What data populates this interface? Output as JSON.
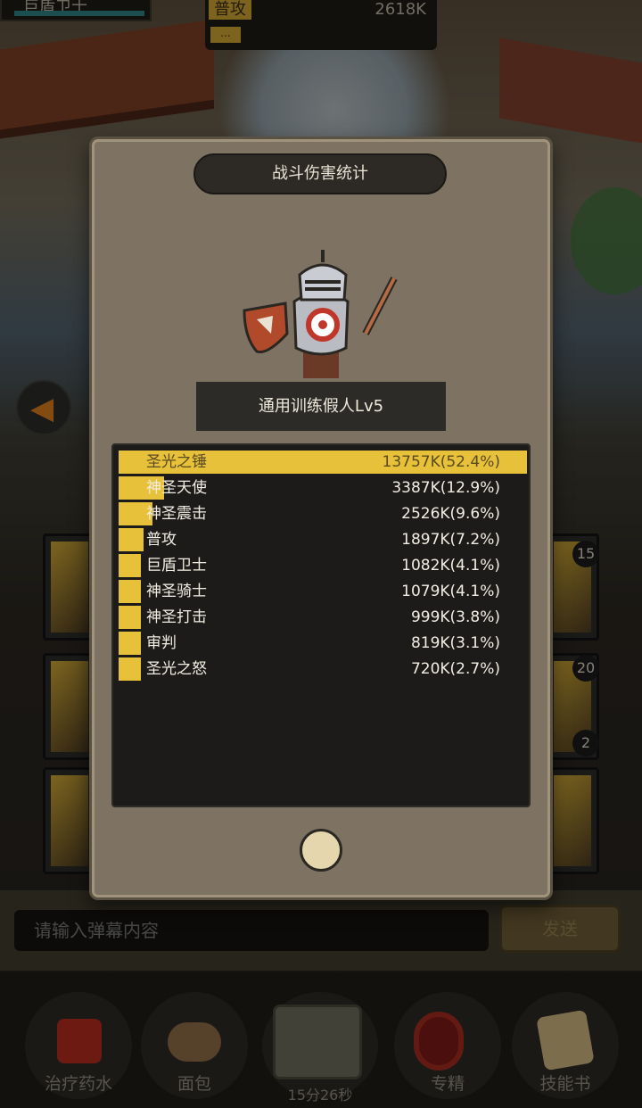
{
  "top_left": {
    "label": "巨盾卫士"
  },
  "top_mid": {
    "name": "普攻",
    "value": "2618K",
    "more": "..."
  },
  "panel": {
    "title": "战斗伤害统计",
    "target": "通用训练假人Lv5",
    "stats": [
      {
        "name": "圣光之锤",
        "value": "13757K(52.4%)",
        "pct": 52.4
      },
      {
        "name": "神圣天使",
        "value": "3387K(12.9%)",
        "pct": 12.9
      },
      {
        "name": "神圣震击",
        "value": "2526K(9.6%)",
        "pct": 9.6
      },
      {
        "name": "普攻",
        "value": "1897K(7.2%)",
        "pct": 7.2
      },
      {
        "name": "巨盾卫士",
        "value": "1082K(4.1%)",
        "pct": 4.1
      },
      {
        "name": "神圣骑士",
        "value": "1079K(4.1%)",
        "pct": 4.1
      },
      {
        "name": "神圣打击",
        "value": "999K(3.8%)",
        "pct": 3.8
      },
      {
        "name": "审判",
        "value": "819K(3.1%)",
        "pct": 3.1
      },
      {
        "name": "圣光之怒",
        "value": "720K(2.7%)",
        "pct": 2.7
      }
    ]
  },
  "side_badges": {
    "b1": "15",
    "b2": "20",
    "b3": "2"
  },
  "chat": {
    "placeholder": "请输入弹幕内容",
    "send": "发送"
  },
  "dock": {
    "items": [
      {
        "label": "治疗药水",
        "icon": "potion-icon"
      },
      {
        "label": "面包",
        "icon": "bread-icon"
      },
      {
        "label": "15分26秒",
        "icon": "chest-icon"
      },
      {
        "label": "专精",
        "icon": "mastery-icon"
      },
      {
        "label": "技能书",
        "icon": "skillbook-icon"
      }
    ]
  },
  "colors": {
    "accent": "#e8c13a",
    "panel": "#7e7363",
    "stats_bg": "#1d1b19"
  }
}
